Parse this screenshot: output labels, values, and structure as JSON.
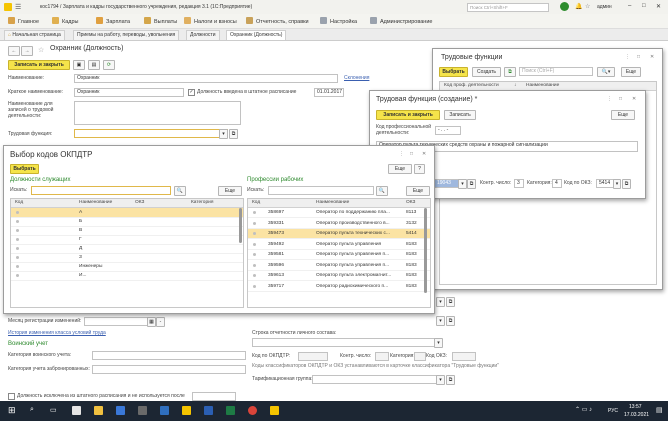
{
  "app": {
    "title": "кос1794 / Зарплата и кадры государственного учреждения, редакция 3.1  (1С:Предприятие)",
    "search_placeholder": "Поиск Ctrl+Shift+F",
    "user": "админ"
  },
  "menu": [
    "Главное",
    "Кадры",
    "Зарплата",
    "Выплаты",
    "Налоги и взносы",
    "Отчетность, справки",
    "Настройка",
    "Администрирование"
  ],
  "tabs": [
    "Начальная страница",
    "Приемы на работу, переводы, увольнения",
    "Должности",
    "Охранник (Должность)"
  ],
  "form": {
    "title": "Охранник (Должность)",
    "save_close": "Записать и закрыть",
    "fields": {
      "name_label": "Наименование:",
      "name_value": "Охранник",
      "inclination": "Склонения",
      "short_label": "Краткое наименование:",
      "short_value": "Охранник",
      "staff_check": "Должность введена в штатное расписание",
      "staff_date": "01.01.2017",
      "record_label": "Наименование для записей о трудовой деятельности:",
      "labor_func_label": "Трудовая функция:"
    },
    "lower": {
      "month_label": "Месяц регистрации изменений:",
      "history_link": "История изменения класса условий труда",
      "military_header": "Воинский учет",
      "military_category": "Категория воинского учета:",
      "military_staff": "Категория учета забронированных:",
      "excluded": "Должность исключена из штатного расписания и не используется после",
      "stat_row": "Строка отчетности личного состава:",
      "okpdtr_label": "Код по ОКПДТР:",
      "control_label": "Контр. число:",
      "category_label": "Категория:",
      "okz_label": "Код ОКЗ:",
      "codes_note": "Коды классификаторов ОКПДТР и ОКЗ устанавливаются в карточке классификатора \"Трудовые функции\"",
      "tariff_label": "Тарификационная группа:"
    }
  },
  "labor_functions": {
    "title": "Трудовые функции",
    "select": "Выбрать",
    "create": "Создать",
    "search_placeholder": "Поиск (Ctrl+F)",
    "more": "Еще",
    "col_code": "Код проф. деятельности",
    "col_name": "Наименование"
  },
  "labor_create": {
    "title": "Трудовая функция (создание) *",
    "save_close": "Записать и закрыть",
    "save": "Записать",
    "more": "Еще",
    "prof_code_label": "Код профессиональной деятельности:",
    "prof_code_value": "- . . -",
    "name_value": "Оператор пульта технических средств охраны и пожарной сигнализации",
    "code_value": "19043",
    "control_label": "Контр. число:",
    "control_value": "3",
    "category_label": "Категория:",
    "category_value": "4",
    "okz_label": "Код по ОКЗ:",
    "okz_value": "5414"
  },
  "okpdtr": {
    "title": "Выбор кодов ОКПДТР",
    "select": "Выбрать",
    "more": "Еще",
    "left_header": "Должности служащих",
    "right_header": "Профессии рабочих",
    "search_label": "Искать:",
    "left_cols": [
      "Код",
      "Наименование",
      "ОКЗ",
      "Категория"
    ],
    "left_rows": [
      {
        "name": "А",
        "sel": true
      },
      {
        "name": "Б",
        "sel": false
      },
      {
        "name": "В",
        "sel": false
      },
      {
        "name": "Г",
        "sel": false
      },
      {
        "name": "Д",
        "sel": false
      },
      {
        "name": "З",
        "sel": false
      },
      {
        "name": "Инженеры",
        "sel": false
      },
      {
        "name": "И...",
        "sel": false
      }
    ],
    "right_cols": [
      "Код",
      "Наименование",
      "ОКЗ"
    ],
    "right_rows": [
      {
        "code": "358697",
        "name": "Оператор по поддержанию пла...",
        "okz": "8113",
        "sel": false
      },
      {
        "code": "359331",
        "name": "Оператор производственного в...",
        "okz": "3132",
        "sel": false
      },
      {
        "code": "359473",
        "name": "Оператор пульта технических с...",
        "okz": "5414",
        "sel": true
      },
      {
        "code": "359492",
        "name": "Оператор пульта управления",
        "okz": "8183",
        "sel": false
      },
      {
        "code": "359581",
        "name": "Оператор пульта управления п...",
        "okz": "8183",
        "sel": false
      },
      {
        "code": "359596",
        "name": "Оператор пульта управления п...",
        "okz": "8183",
        "sel": false
      },
      {
        "code": "359613",
        "name": "Оператор пульта электромагнит...",
        "okz": "8183",
        "sel": false
      },
      {
        "code": "359717",
        "name": "Оператор радиохимического п...",
        "okz": "8183",
        "sel": false
      }
    ]
  },
  "taskbar": {
    "lang": "РУС",
    "time": "13:57",
    "date": "17.03.2021"
  },
  "colors": {
    "accent": "#f5e44a",
    "green": "#2e8a2e",
    "selection": "#fbe3a3"
  }
}
